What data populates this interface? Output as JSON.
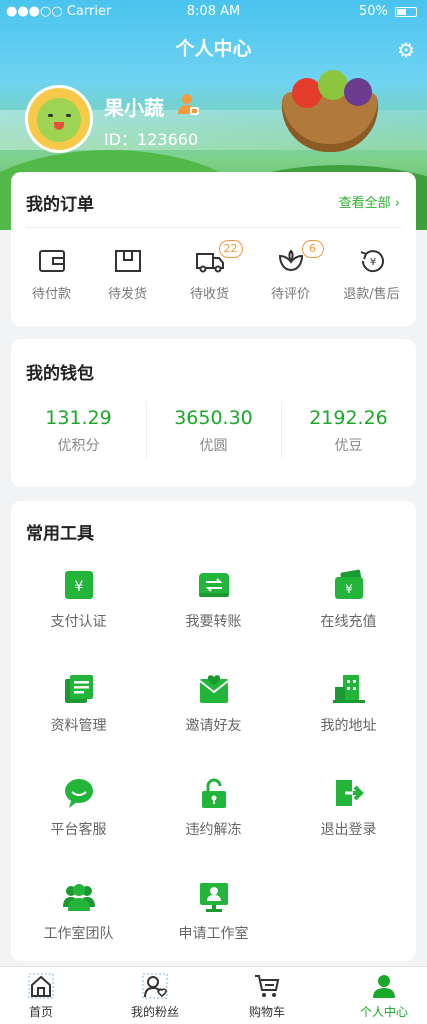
{
  "status_bar": {
    "carrier": "●●●○○ Carrier",
    "time": "8:08 AM",
    "battery": "50%"
  },
  "header": {
    "title": "个人中心",
    "username": "果小蔬",
    "user_id": "ID：123660"
  },
  "orders": {
    "title": "我的订单",
    "view_all": "查看全部 ›",
    "items": [
      {
        "label": "待付款",
        "icon": "wallet-icon",
        "badge": null
      },
      {
        "label": "待发货",
        "icon": "package-icon",
        "badge": null
      },
      {
        "label": "待收货",
        "icon": "truck-icon",
        "badge": "22"
      },
      {
        "label": "待评价",
        "icon": "flower-icon",
        "badge": "6"
      },
      {
        "label": "退款/售后",
        "icon": "refund-icon",
        "badge": null
      }
    ]
  },
  "wallet": {
    "title": "我的钱包",
    "items": [
      {
        "value": "131.29",
        "label": "优积分"
      },
      {
        "value": "3650.30",
        "label": "优圆"
      },
      {
        "value": "2192.26",
        "label": "优豆"
      }
    ]
  },
  "tools": {
    "title": "常用工具",
    "items": [
      {
        "label": "支付认证",
        "icon": "yen-card-icon"
      },
      {
        "label": "我要转账",
        "icon": "transfer-icon"
      },
      {
        "label": "在线充值",
        "icon": "recharge-icon"
      },
      {
        "label": "资料管理",
        "icon": "document-icon"
      },
      {
        "label": "邀请好友",
        "icon": "invite-mail-icon"
      },
      {
        "label": "我的地址",
        "icon": "building-icon"
      },
      {
        "label": "平台客服",
        "icon": "chat-icon"
      },
      {
        "label": "违约解冻",
        "icon": "unlock-icon"
      },
      {
        "label": "退出登录",
        "icon": "logout-icon"
      },
      {
        "label": "工作室团队",
        "icon": "team-icon"
      },
      {
        "label": "申请工作室",
        "icon": "workstation-icon"
      }
    ]
  },
  "tabbar": {
    "items": [
      {
        "label": "首页",
        "icon": "home-icon"
      },
      {
        "label": "我的粉丝",
        "icon": "fans-icon"
      },
      {
        "label": "购物车",
        "icon": "cart-icon"
      },
      {
        "label": "个人中心",
        "icon": "profile-icon"
      }
    ],
    "active_index": 3
  },
  "colors": {
    "accent": "#1aa828",
    "badge": "#f39a3d"
  }
}
